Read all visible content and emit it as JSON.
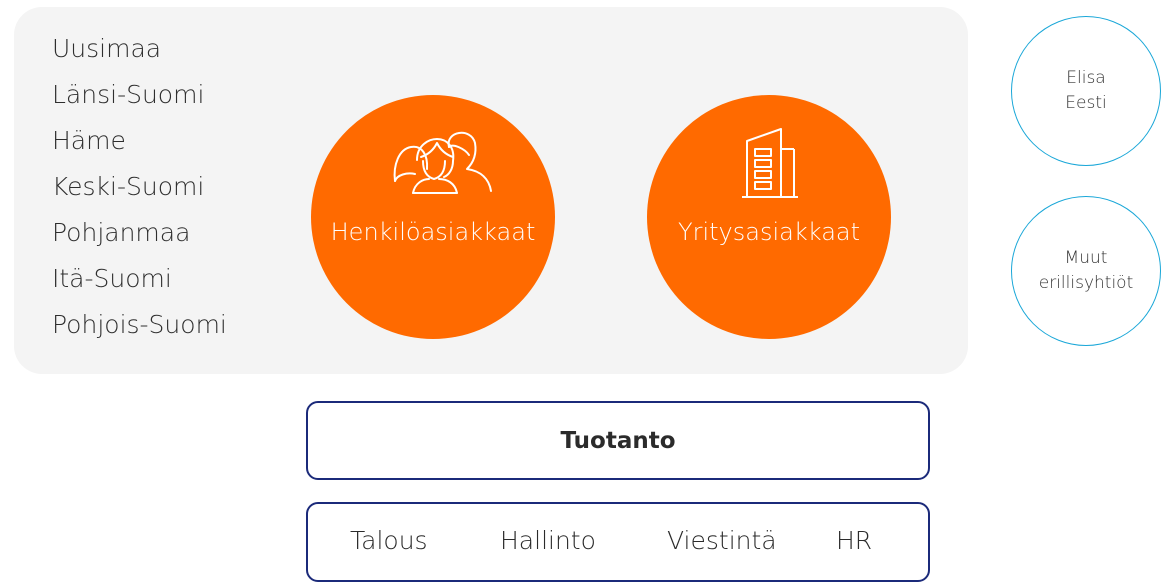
{
  "regions": [
    "Uusimaa",
    "Länsi-Suomi",
    "Häme",
    "Keski-Suomi",
    "Pohjanmaa",
    "Itä-Suomi",
    "Pohjois-Suomi"
  ],
  "segments": {
    "consumer": {
      "label": "Henkilöasiakkaat",
      "icon": "people-icon"
    },
    "corporate": {
      "label": "Yritysasiakkaat",
      "icon": "building-icon"
    }
  },
  "subsidiaries": [
    {
      "lines": [
        "Elisa",
        "Eesti"
      ]
    },
    {
      "lines": [
        "Muut",
        "erillisyhtiöt"
      ]
    }
  ],
  "production": {
    "label": "Tuotanto"
  },
  "support_functions": [
    "Talous",
    "Hallinto",
    "Viestintä",
    "HR"
  ],
  "colors": {
    "segment_fill": "#ff6a00",
    "subsidiary_border": "#1aa7d8",
    "bar_border": "#1b2a7a",
    "panel_background": "#f4f4f4"
  }
}
